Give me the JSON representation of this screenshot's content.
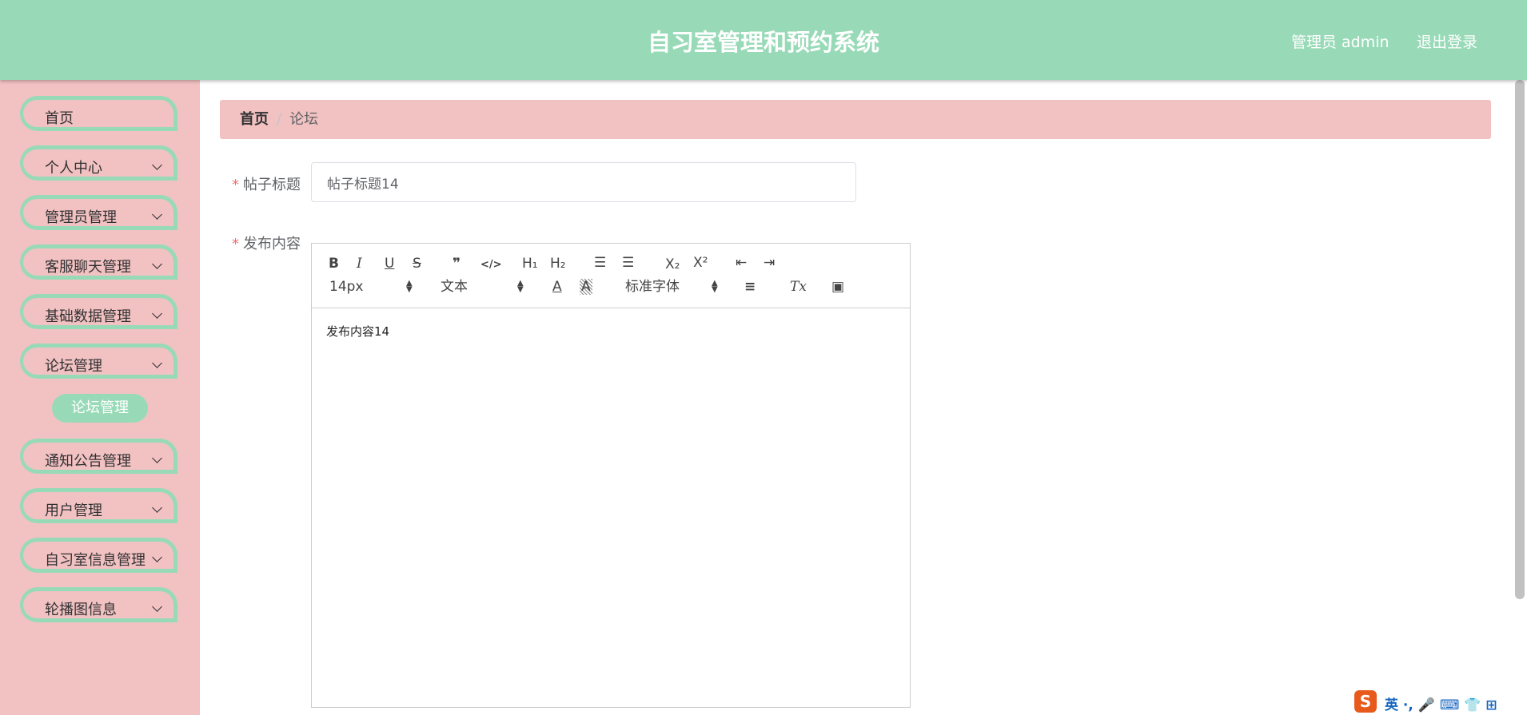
{
  "header": {
    "title": "自习室管理和预约系统",
    "user_label": "管理员 admin",
    "logout_label": "退出登录"
  },
  "sidebar": {
    "items": [
      {
        "label": "首页",
        "has_arrow": false
      },
      {
        "label": "个人中心",
        "has_arrow": true
      },
      {
        "label": "管理员管理",
        "has_arrow": true
      },
      {
        "label": "客服聊天管理",
        "has_arrow": true
      },
      {
        "label": "基础数据管理",
        "has_arrow": true
      },
      {
        "label": "论坛管理",
        "has_arrow": true
      },
      {
        "label": "通知公告管理",
        "has_arrow": true
      },
      {
        "label": "用户管理",
        "has_arrow": true
      },
      {
        "label": "自习室信息管理",
        "has_arrow": true
      },
      {
        "label": "轮播图信息",
        "has_arrow": true
      }
    ],
    "active_submenu": "论坛管理"
  },
  "breadcrumb": {
    "home": "首页",
    "separator": "/",
    "current": "论坛"
  },
  "form": {
    "required_mark": "*",
    "title_label": "帖子标题",
    "title_value": "帖子标题14",
    "content_label": "发布内容",
    "content_value": "发布内容14"
  },
  "editor_toolbar": {
    "bold": "B",
    "italic": "I",
    "underline": "U",
    "strike": "S",
    "quote": "❞",
    "code": "</>",
    "h1": "H₁",
    "h2": "H₂",
    "ordered_list": "☰",
    "bullet_list": "☰",
    "subscript": "X₂",
    "superscript": "X²",
    "outdent": "⇤",
    "indent": "⇥",
    "size_value": "14px",
    "header_value": "文本",
    "font_value": "标准字体",
    "color": "A",
    "background": "A",
    "align": "≡",
    "clean": "Tx",
    "image": "▣"
  },
  "ime": {
    "logo": "S",
    "text": "英 ·, 🎤 ⌨ 👕 ⊞"
  },
  "colors": {
    "header_bg": "#98dab7",
    "sidebar_bg": "#f2c1c1",
    "menu_border": "#98dab7",
    "required": "#f56c6c"
  }
}
